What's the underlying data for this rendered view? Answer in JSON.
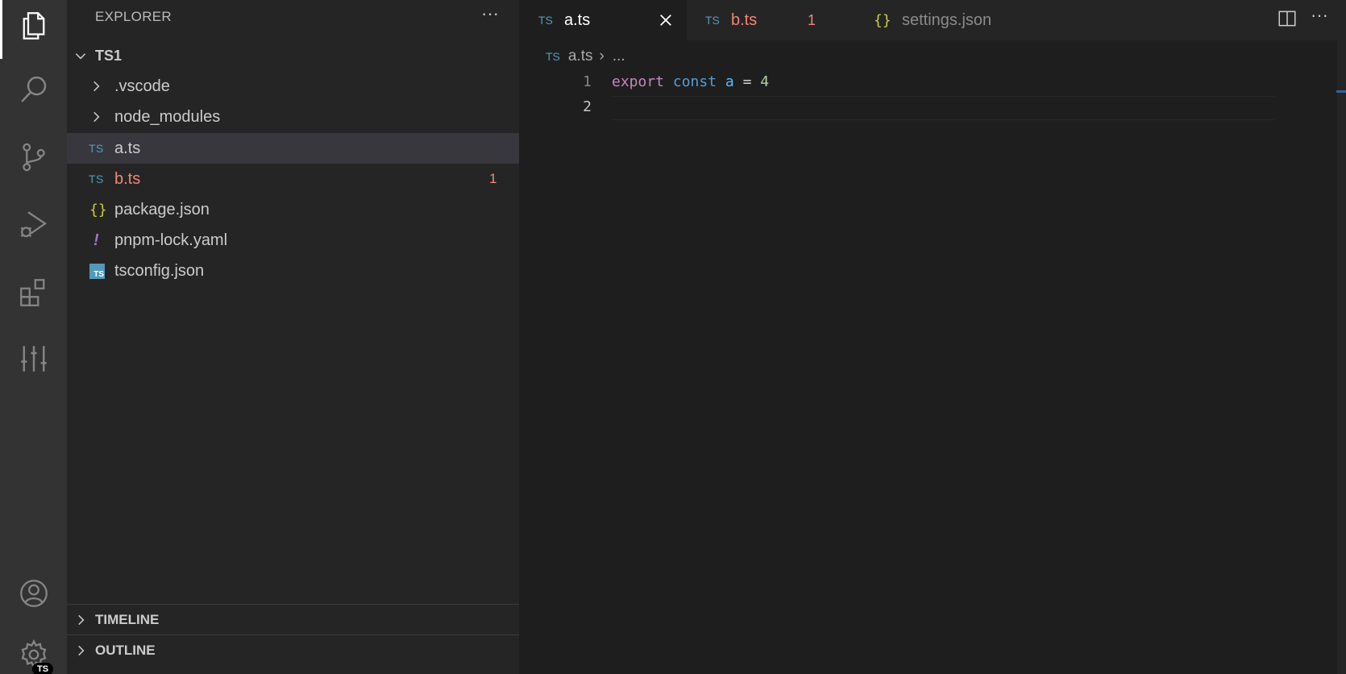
{
  "sidebar": {
    "title": "EXPLORER",
    "more_label": "···",
    "root_folder": "TS1",
    "items": [
      {
        "label": ".vscode",
        "kind": "folder"
      },
      {
        "label": "node_modules",
        "kind": "folder"
      },
      {
        "label": "a.ts",
        "kind": "ts",
        "icon_text": "TS"
      },
      {
        "label": "b.ts",
        "kind": "ts",
        "icon_text": "TS",
        "problems": "1"
      },
      {
        "label": "package.json",
        "kind": "json",
        "icon_text": "{}"
      },
      {
        "label": "pnpm-lock.yaml",
        "kind": "yaml",
        "icon_text": "!"
      },
      {
        "label": "tsconfig.json",
        "kind": "tsconfig",
        "icon_text": "TS"
      }
    ],
    "panels": [
      {
        "label": "TIMELINE"
      },
      {
        "label": "OUTLINE"
      }
    ]
  },
  "activity_bar": {
    "items": [
      "explorer-icon",
      "search-icon",
      "source-control-icon",
      "run-debug-icon",
      "extensions-icon",
      "testing-icon"
    ],
    "bottom": [
      "account-icon",
      "settings-gear-icon"
    ],
    "badge": "TS"
  },
  "tabs": [
    {
      "label": "a.ts",
      "icon_text": "TS",
      "active": true
    },
    {
      "label": "b.ts",
      "icon_text": "TS",
      "problems": "1"
    },
    {
      "label": "settings.json",
      "icon_text": "{}"
    }
  ],
  "breadcrumb": {
    "icon_text": "TS",
    "file": "a.ts",
    "separator": "›",
    "more": "..."
  },
  "editor": {
    "line_numbers": [
      "1",
      "2"
    ],
    "line1": {
      "kw": "export",
      "kw2": "const",
      "ident": "a",
      "op": "=",
      "num": "4"
    }
  },
  "colors": {
    "accent_ts": "#519aba",
    "error": "#f48771",
    "json": "#cbcb41",
    "yaml": "#a074c4"
  }
}
